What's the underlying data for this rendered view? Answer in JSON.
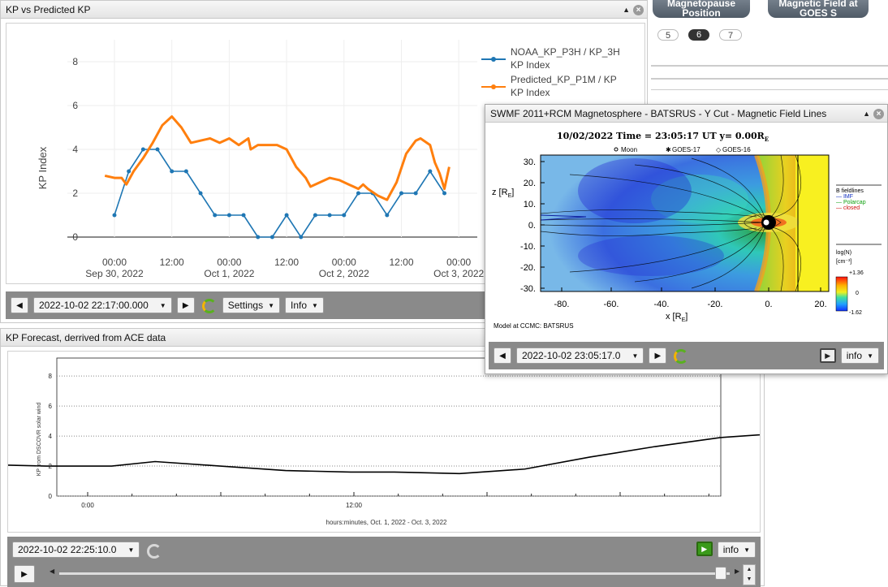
{
  "kp_panel": {
    "title": "KP vs Predicted KP",
    "y_axis_label": "KP Index",
    "legend": [
      "NOAA_KP_P3H / KP_3H",
      "KP Index",
      "Predicted_KP_P1M / KP",
      "KP Index"
    ],
    "toolbar": {
      "datetime": "2022-10-02 22:17:00.000",
      "settings_label": "Settings",
      "info_label": "Info"
    }
  },
  "forecast_panel": {
    "title": "KP Forecast, derrived from ACE data",
    "y_axis_label": "KP from DSCOVR solar wind",
    "x_axis_label": "hours:minutes, Oct. 1, 2022 - Oct. 3, 2022",
    "toolbar": {
      "datetime": "2022-10-02 22:25:10.0",
      "info_label": "info"
    }
  },
  "magneto_panel": {
    "title": "SWMF 2011+RCM Magnetosphere - BATSRUS - Y Cut - Magnetic Field Lines",
    "plot_header": "10/02/2022 Time = 23:05:17 UT y= 0.00R",
    "plot_header_sub": "E",
    "markers": [
      "Moon",
      "GOES-17",
      "GOES-16"
    ],
    "legend_title": "B fieldlines",
    "legend_items": [
      "IMF",
      "Polarcap",
      "closed"
    ],
    "colorbar_title": "log(N)",
    "colorbar_unit": "[cm⁻³]",
    "colorbar_max": "+1.36",
    "colorbar_mid": "0",
    "colorbar_min": "-1.62",
    "x_label": "x [R",
    "z_label": "z [R",
    "footer": "Model at CCMC: BATSRUS",
    "toolbar": {
      "datetime": "2022-10-02 23:05:17.0",
      "info_label": "info"
    }
  },
  "top_right": {
    "btn1": [
      "Magnetopause",
      "Position"
    ],
    "btn2": [
      "Magnetic Field at",
      "GOES S"
    ],
    "pages": [
      "5",
      "6",
      "7"
    ]
  },
  "chart_data": [
    {
      "type": "line",
      "title": "",
      "ylabel": "KP Index",
      "xlabel": "",
      "ylim": [
        -0.7,
        8.6
      ],
      "x_ticks": [
        "00:00|Sep 30, 2022",
        "12:00",
        "00:00|Oct 1, 2022",
        "12:00",
        "00:00|Oct 2, 2022",
        "12:00",
        "00:00|Oct 3, 2022"
      ],
      "y_ticks": [
        0,
        2,
        4,
        6,
        8
      ],
      "series": [
        {
          "name": "NOAA_KP_P3H / KP_3H KP Index",
          "color": "#1f77b4",
          "x_hours": [
            0,
            3,
            6,
            9,
            12,
            15,
            18,
            21,
            24,
            27,
            30,
            33,
            36,
            39,
            42,
            45,
            48,
            51,
            54,
            57,
            60,
            63,
            66,
            69
          ],
          "values": [
            1,
            3,
            4,
            4,
            3,
            3,
            2,
            1,
            1,
            1,
            0,
            0,
            1,
            0,
            1,
            1,
            1,
            2,
            2,
            1,
            2,
            2,
            3,
            2
          ]
        },
        {
          "name": "Predicted_KP_P1M / KP KP Index",
          "color": "#ff7f0e",
          "x_hours": [
            -2,
            0,
            1.5,
            2.5,
            4,
            6,
            8,
            10,
            12,
            14,
            16,
            18,
            20,
            22,
            24,
            26,
            28,
            28.5,
            30,
            32,
            34,
            36,
            38,
            40,
            41,
            43,
            45,
            47,
            49,
            50,
            51,
            52,
            53,
            55,
            57,
            59,
            61,
            63,
            64,
            66,
            67,
            68,
            69,
            70
          ],
          "values": [
            2.8,
            2.7,
            2.7,
            2.4,
            3.0,
            3.6,
            4.3,
            5.1,
            5.5,
            5.0,
            4.3,
            4.4,
            4.5,
            4.3,
            4.5,
            4.2,
            4.5,
            4.0,
            4.2,
            4.2,
            4.2,
            4.0,
            3.2,
            2.7,
            2.3,
            2.5,
            2.7,
            2.6,
            2.4,
            2.3,
            2.2,
            2.4,
            2.2,
            1.9,
            1.7,
            2.5,
            3.8,
            4.4,
            4.5,
            4.2,
            3.4,
            2.9,
            2.2,
            3.2
          ]
        }
      ]
    },
    {
      "type": "line",
      "ylabel": "KP from DSCOVR solar wind",
      "xlabel": "hours:minutes, Oct. 1, 2022 - Oct. 3, 2022",
      "ylim": [
        0,
        9
      ],
      "x_ticks": [
        "0:00",
        "12:00",
        "0:00"
      ],
      "y_ticks": [
        0,
        2,
        4,
        6,
        8
      ],
      "series": [
        {
          "name": "",
          "color": "#000000",
          "x_hours": [
            -8,
            -5,
            -2,
            1,
            3,
            6,
            9,
            12,
            14,
            17,
            20,
            23,
            26,
            29,
            32,
            35,
            38,
            40,
            41,
            43,
            45,
            47,
            49,
            51,
            52,
            55,
            58,
            59,
            61
          ],
          "values": [
            2.3,
            2.1,
            2.0,
            2.0,
            2.3,
            2.0,
            1.7,
            1.6,
            1.6,
            1.5,
            1.8,
            2.6,
            3.3,
            3.9,
            4.2,
            4.5,
            4.4,
            4.5,
            4.5,
            4.4,
            4.1,
            3.6,
            3.2,
            3.0,
            2.7,
            2.2,
            2.1,
            2.6,
            4.2
          ]
        }
      ]
    }
  ]
}
